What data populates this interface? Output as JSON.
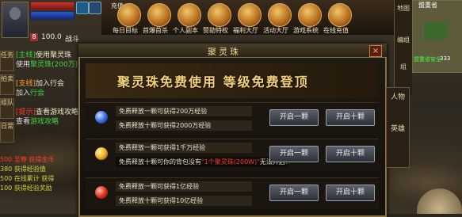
{
  "top": {
    "level": "100.0",
    "level_label": "战斗",
    "lvl_badge": "8",
    "charge_label": "充值",
    "icons": [
      {
        "label": "每日目标",
        "icon": "target-icon"
      },
      {
        "label": "首爆首杀",
        "icon": "sword-icon"
      },
      {
        "label": "个人副本",
        "icon": "dungeon-icon"
      },
      {
        "label": "赞助特权",
        "icon": "crown-icon"
      },
      {
        "label": "福利大厅",
        "icon": "gift-icon"
      },
      {
        "label": "活动大厅",
        "icon": "event-icon"
      },
      {
        "label": "游戏系统",
        "icon": "system-icon"
      },
      {
        "label": "在线充值",
        "icon": "recharge-icon"
      }
    ]
  },
  "right_tabs": [
    "地图",
    "编组",
    "组"
  ],
  "minimap": {
    "title": "盟重省",
    "label": "盟重省安全",
    "coords": "333"
  },
  "left": {
    "side_buttons": [
      "任务",
      "拍卖",
      "组队",
      "日常"
    ],
    "quests": [
      {
        "tag": "[主线]",
        "tag_color": "#3fd23f",
        "text": "使用聚灵珠",
        "sub": "使用",
        "sub_hl": "聚灵珠(200万)"
      },
      {
        "tag": "[支线]",
        "tag_color": "#ff9f2a",
        "text": "加入行会",
        "sub": "加入",
        "sub_hl": "行会"
      },
      {
        "tag": "[提示]",
        "tag_color": "#ff3a2a",
        "text": "查看游戏攻略",
        "sub": "查看",
        "sub_hl": "游戏攻略"
      }
    ],
    "chat": [
      {
        "text": "500 至尊 获得金币",
        "color": "#ff3a2a"
      },
      {
        "text": "380 获得经验值",
        "color": "#d0d040"
      },
      {
        "text": "500 在线累计 获得",
        "color": "#d0d040"
      },
      {
        "text": "100 获得经验奖励",
        "color": "#d0d040"
      }
    ]
  },
  "dialog": {
    "title": "聚灵珠",
    "close": "×",
    "banner": "聚灵珠免费使用  等级免费登顶",
    "rows": [
      {
        "orb_color": "#3a6fe0",
        "line1": "免费释放一颗可获得200万经验",
        "line2": "免费释放十颗可获得2000万经验",
        "btn1": "开启一颗",
        "btn2": "开启十颗"
      },
      {
        "orb_color": "#f0b020",
        "line1": "免费释放一颗可获得1千万经验",
        "warn_pre": "免费释放十颗可你的背包没有",
        "warn_red": "\"1个聚灵珠(200W)\"",
        "warn_post": "无法开启!",
        "btn1": "开启一颗",
        "btn2": "开启十颗"
      },
      {
        "orb_color": "#e03020",
        "line1": "免费释放一颗可获得1亿经验",
        "line2": "免费释放十颗可获得10亿经验",
        "btn1": "开启一颗",
        "btn2": "开启十颗"
      }
    ]
  },
  "char_tabs": [
    "人物",
    "英雄"
  ]
}
